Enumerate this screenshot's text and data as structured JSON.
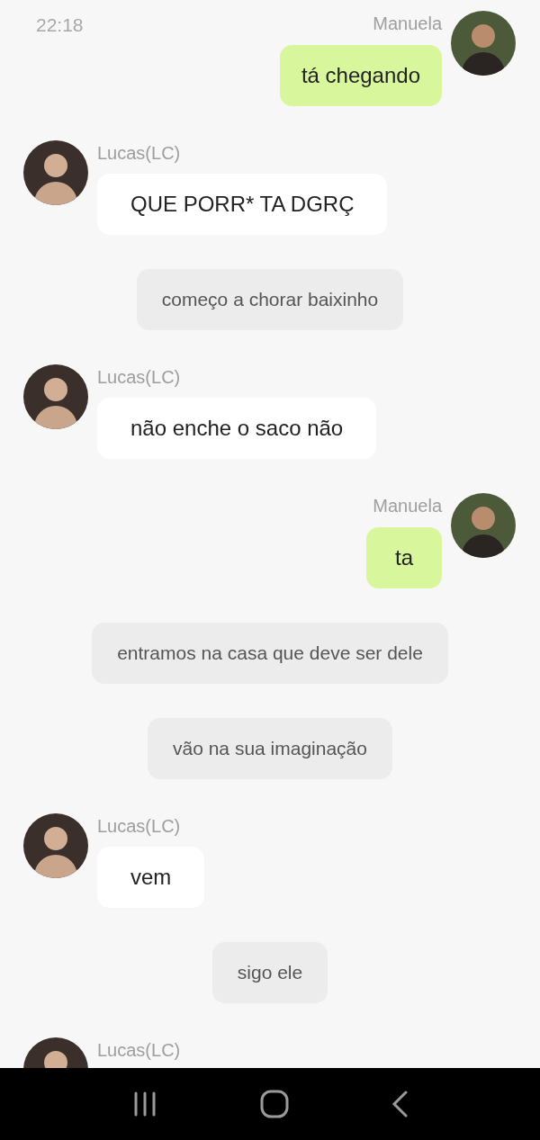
{
  "status_bar": {
    "time": "22:18"
  },
  "messages": [
    {
      "kind": "sent",
      "sender": "Manuela",
      "text": "tá chegando"
    },
    {
      "kind": "received",
      "sender": "Lucas(LC)",
      "text": "QUE PORR* TA DGRÇ"
    },
    {
      "kind": "narration",
      "text": "começo a chorar baixinho"
    },
    {
      "kind": "received",
      "sender": "Lucas(LC)",
      "text": "não enche o saco não"
    },
    {
      "kind": "sent",
      "sender": "Manuela",
      "text": "ta"
    },
    {
      "kind": "narration",
      "text": "entramos na casa que deve ser dele"
    },
    {
      "kind": "narration",
      "text": "vão na sua imaginação"
    },
    {
      "kind": "received",
      "sender": "Lucas(LC)",
      "text": "vem"
    },
    {
      "kind": "narration",
      "text": "sigo ele"
    },
    {
      "kind": "received",
      "sender": "Lucas(LC)"
    }
  ]
}
